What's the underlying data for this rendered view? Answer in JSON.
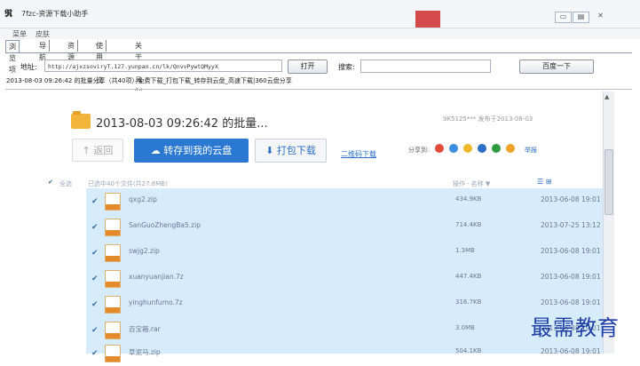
{
  "window": {
    "title": "7fzc-资源下载小助手",
    "min_label": "▭",
    "max_label": "▤",
    "close_label": "✕"
  },
  "menu": [
    "菜单",
    "皮肤"
  ],
  "tabs": [
    "浏览项",
    "导航",
    "资源",
    "使用协议",
    "关于工具制作"
  ],
  "address": {
    "label": "地址:",
    "value": "http://ajxzsoviryT.127.yunpan.cn/lk/QnvvPywtQMyyX",
    "open_button": "打开"
  },
  "search": {
    "label": "搜索:",
    "value": "",
    "button": "百度一下"
  },
  "status_line": "2013-08-03 09:26:42 的批量分享（共40项）免费下载_打包下载_转存到云盘_高速下载|360云盘分享",
  "share": {
    "title": "2013-08-03 09:26:42 的批量...",
    "meta": "9K5125*** 发布于2013-08-03",
    "back_label": "↑ 返回",
    "save_label": "转存到我的云盘",
    "download_label": "打包下载",
    "qr_label": "二维码下载",
    "share_to_label": "分享到:",
    "report_label": "举报",
    "icons": [
      "weibo-icon",
      "qzone-icon",
      "star-icon",
      "renren-icon",
      "douban-icon",
      "kaixin-icon"
    ],
    "icon_colors": [
      "#e24a3a",
      "#3b8ee0",
      "#f0b72a",
      "#2a6ec8",
      "#2e9c3e",
      "#f0a22a"
    ]
  },
  "list_header": {
    "select_all": "全选",
    "count": "已选中40个文件(共27.8MB)",
    "sort": "操作 · 名称 ▼",
    "view": "☰  ⊞"
  },
  "files": [
    {
      "name": "qxg2.zip",
      "size": "434.9KB",
      "date": "2013-06-08 19:01"
    },
    {
      "name": "SanGuoZhengBa5.zip",
      "size": "714.4KB",
      "date": "2013-07-25 13:12"
    },
    {
      "name": "swjg2.zip",
      "size": "1.3MB",
      "date": "2013-06-08 19:01"
    },
    {
      "name": "xuanyuanjian.7z",
      "size": "447.4KB",
      "date": "2013-06-08 19:01"
    },
    {
      "name": "yinghunfumo.7z",
      "size": "316.7KB",
      "date": "2013-06-08 19:01"
    },
    {
      "name": "百宝箱.rar",
      "size": "3.0MB",
      "date": "2013-06-08 19:01"
    },
    {
      "name": "草泥马.zip",
      "size": "504.1KB",
      "date": "2013-06-08 19:01"
    }
  ],
  "watermark": "最需教育"
}
